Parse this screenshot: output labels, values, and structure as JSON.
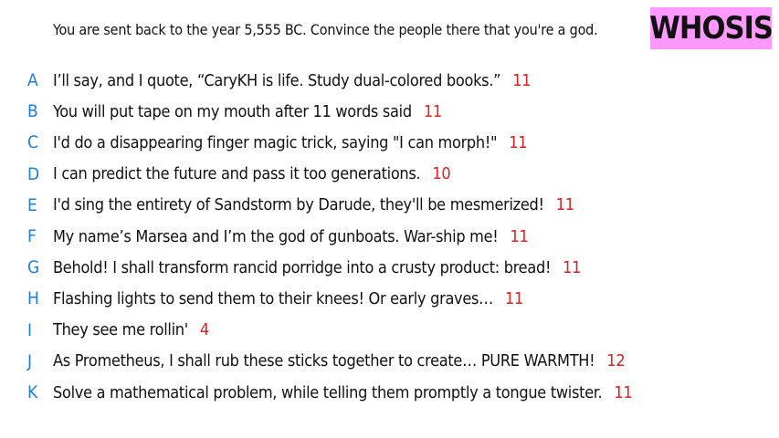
{
  "prompt": "You are sent back to the year 5,555 BC. Convince the people there that you're a god.",
  "badge": "WHOSIS",
  "colors": {
    "letter": "#1e7fd6",
    "count": "#e02020",
    "badge_bg": "#ff99ff"
  },
  "responses": [
    {
      "letter": "A",
      "text": "I’ll say, and I quote, “CaryKH is life. Study dual-colored books.”",
      "count": "11"
    },
    {
      "letter": "B",
      "text": "You will put tape on my mouth after 11 words said",
      "count": "11"
    },
    {
      "letter": "C",
      "text": "I'd do a disappearing finger magic trick, saying \"I can morph!\"",
      "count": "11"
    },
    {
      "letter": "D",
      "text": "I can predict the future and pass it too generations.",
      "count": "10"
    },
    {
      "letter": "E",
      "text": "I'd sing the entirety of Sandstorm by Darude, they'll be mesmerized!",
      "count": "11"
    },
    {
      "letter": "F",
      "text": "My name’s Marsea and I’m the god of gunboats. War-ship me!",
      "count": "11"
    },
    {
      "letter": "G",
      "text": "Behold! I shall transform rancid porridge into a crusty product: bread!",
      "count": "11"
    },
    {
      "letter": "H",
      "text": "Flashing lights to send them to their knees! Or early graves…",
      "count": "11"
    },
    {
      "letter": "I",
      "text": "They see me rollin'",
      "count": "4"
    },
    {
      "letter": "J",
      "text": "As Prometheus, I shall rub these sticks together to create… PURE WARMTH!",
      "count": "12"
    },
    {
      "letter": "K",
      "text": "Solve a mathematical problem, while telling them promptly a tongue twister.",
      "count": "11"
    }
  ]
}
